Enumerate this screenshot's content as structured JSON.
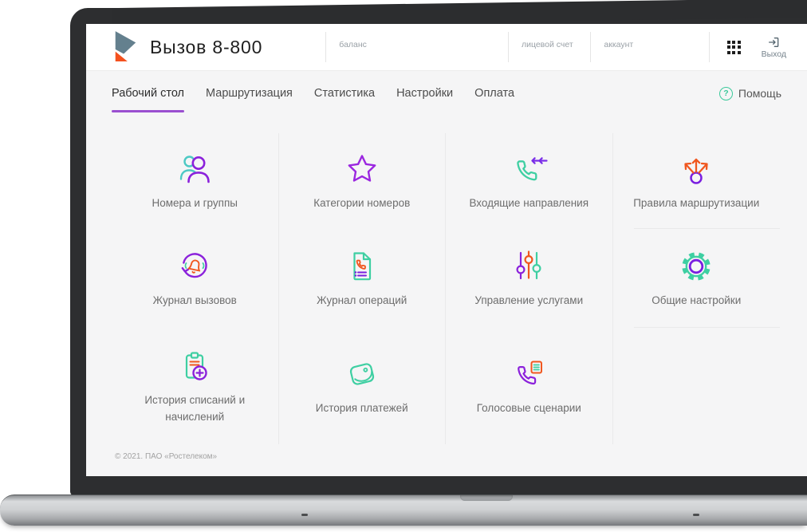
{
  "header": {
    "title": "Вызов 8-800",
    "fields": [
      {
        "label": "баланс"
      },
      {
        "label": "лицевой счет"
      },
      {
        "label": "аккаунт"
      }
    ],
    "exit_label": "Выход"
  },
  "nav": {
    "tabs": [
      {
        "label": "Рабочий стол",
        "active": true
      },
      {
        "label": "Маршрутизация",
        "active": false
      },
      {
        "label": "Статистика",
        "active": false
      },
      {
        "label": "Настройки",
        "active": false
      },
      {
        "label": "Оплата",
        "active": false
      }
    ],
    "help_label": "Помощь"
  },
  "tiles": [
    {
      "label": "Номера и группы",
      "icon": "people-icon"
    },
    {
      "label": "Категории номеров",
      "icon": "star-icon"
    },
    {
      "label": "Входящие направления",
      "icon": "incoming-call-icon"
    },
    {
      "label": "Правила маршрутизации",
      "icon": "routing-arrows-icon"
    },
    {
      "label": "Журнал вызовов",
      "icon": "bell-refresh-icon"
    },
    {
      "label": "Журнал операций",
      "icon": "document-phone-icon"
    },
    {
      "label": "Управление услугами",
      "icon": "sliders-icon"
    },
    {
      "label": "Общие настройки",
      "icon": "gear-icon"
    },
    {
      "label": "История списаний и начислений",
      "icon": "clipboard-plus-icon"
    },
    {
      "label": "История платежей",
      "icon": "wallet-icon"
    },
    {
      "label": "Голосовые сценарии",
      "icon": "phone-script-icon"
    }
  ],
  "footer": {
    "copyright": "© 2021. ПАО «Ростелеком»"
  },
  "colors": {
    "accent_purple": "#8b21db",
    "accent_green": "#3ecfa2",
    "accent_orange": "#f0571f",
    "tab_underline": "#9a4fd0",
    "help_green": "#3cc99b",
    "content_bg": "#f5f5f6"
  }
}
